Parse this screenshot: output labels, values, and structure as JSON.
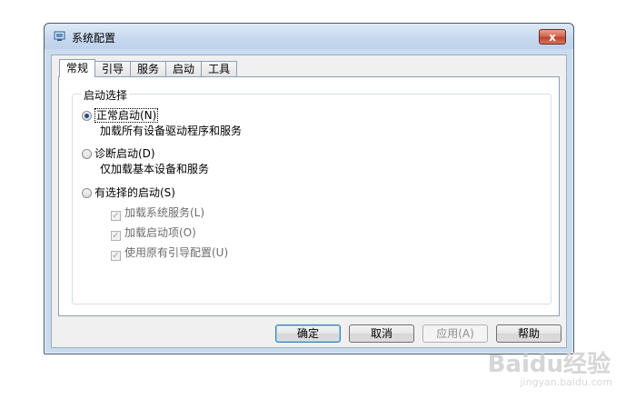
{
  "window": {
    "title": "系统配置",
    "close_label": "x"
  },
  "tabs": [
    {
      "label": "常规",
      "active": true
    },
    {
      "label": "引导",
      "active": false
    },
    {
      "label": "服务",
      "active": false
    },
    {
      "label": "启动",
      "active": false
    },
    {
      "label": "工具",
      "active": false
    }
  ],
  "startup_group": {
    "label": "启动选择",
    "normal": {
      "label": "正常启动(N)",
      "description": "加载所有设备驱动程序和服务",
      "selected": true
    },
    "diagnostic": {
      "label": "诊断启动(D)",
      "description": "仅加载基本设备和服务",
      "selected": false
    },
    "selective": {
      "label": "有选择的启动(S)",
      "selected": false
    },
    "selective_options": [
      {
        "label": "加载系统服务(L)",
        "checked": true,
        "enabled": false
      },
      {
        "label": "加载启动项(O)",
        "checked": true,
        "enabled": false
      },
      {
        "label": "使用原有引导配置(U)",
        "checked": true,
        "enabled": false
      }
    ]
  },
  "buttons": {
    "ok": "确定",
    "cancel": "取消",
    "apply": "应用(A)",
    "help": "帮助"
  },
  "watermark": {
    "text": "Baidu经验",
    "sub": "jingyan.baidu.com"
  }
}
